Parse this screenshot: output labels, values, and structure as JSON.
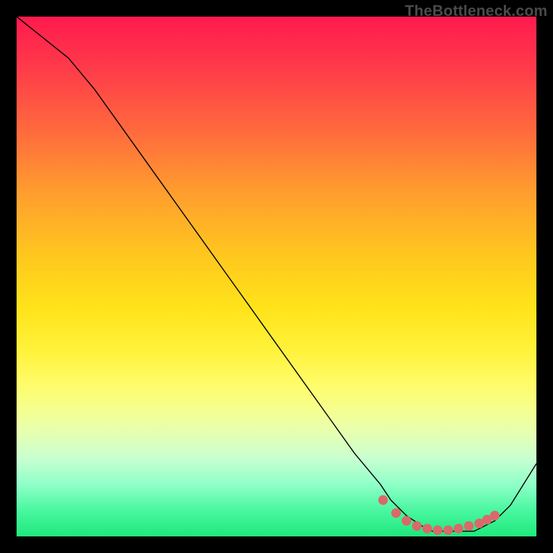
{
  "watermark": "TheBottleneck.com",
  "chart_data": {
    "type": "line",
    "title": "",
    "xlabel": "",
    "ylabel": "",
    "xlim": [
      0,
      100
    ],
    "ylim": [
      0,
      100
    ],
    "grid": false,
    "series": [
      {
        "name": "curve",
        "x": [
          0,
          5,
          10,
          15,
          20,
          25,
          30,
          35,
          40,
          45,
          50,
          55,
          60,
          65,
          70,
          72,
          75,
          78,
          80,
          82,
          85,
          88,
          90,
          92,
          95,
          100
        ],
        "y": [
          100,
          96,
          92,
          86,
          79,
          72,
          65,
          58,
          51,
          44,
          37,
          30,
          23,
          16,
          10,
          7,
          4,
          2,
          1,
          1,
          1,
          1,
          2,
          3,
          6,
          14
        ]
      }
    ],
    "markers": {
      "name": "highlight-dots",
      "x": [
        70.5,
        73,
        75,
        77,
        79,
        81,
        83,
        85,
        87,
        89,
        90.5,
        92
      ],
      "y": [
        7.0,
        4.5,
        3.0,
        2.0,
        1.5,
        1.2,
        1.2,
        1.5,
        2.0,
        2.5,
        3.2,
        4.0
      ],
      "color": "#d86a6a",
      "radius": 7
    },
    "line_color": "#000000",
    "line_width": 1.5
  }
}
